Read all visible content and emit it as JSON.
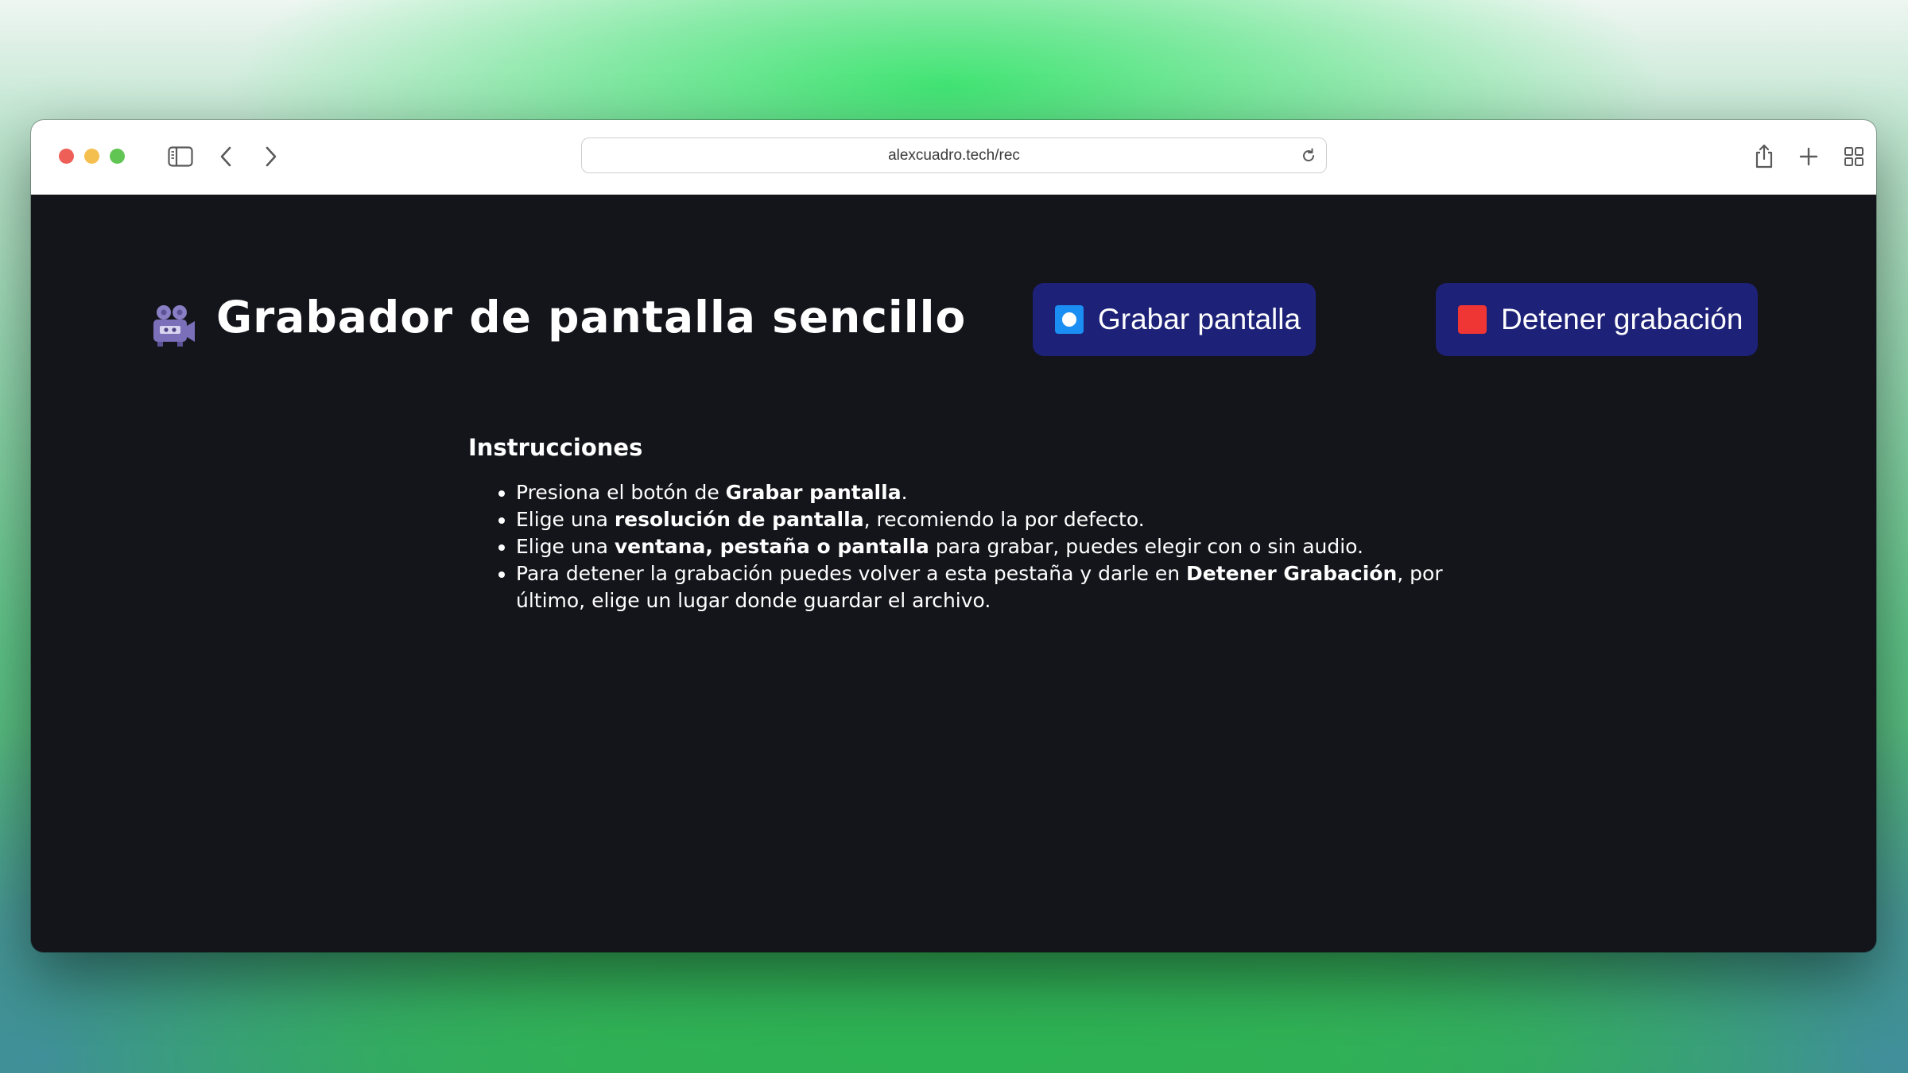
{
  "browser": {
    "url": "alexcuadro.tech/rec"
  },
  "page": {
    "title": "Grabador de pantalla sencillo",
    "hero_icon": "video-camera-icon",
    "record_button": {
      "label": "Grabar pantalla",
      "icon": "record-button-icon",
      "color": "#1d2177",
      "icon_color": "#1a8ef2"
    },
    "stop_button": {
      "label": "Detener grabación",
      "icon": "stop-square-icon",
      "color": "#1d2177",
      "icon_color": "#f03535"
    },
    "background_color": "#14141b"
  },
  "instructions": {
    "heading": "Instrucciones",
    "items": [
      {
        "parts": [
          {
            "text": "Presiona el botón de ",
            "bold": false
          },
          {
            "text": "Grabar pantalla",
            "bold": true
          },
          {
            "text": ".",
            "bold": false
          }
        ]
      },
      {
        "parts": [
          {
            "text": "Elige una ",
            "bold": false
          },
          {
            "text": "resolución de pantalla",
            "bold": true
          },
          {
            "text": ", recomiendo la por defecto.",
            "bold": false
          }
        ]
      },
      {
        "parts": [
          {
            "text": "Elige una ",
            "bold": false
          },
          {
            "text": "ventana, pestaña o pantalla",
            "bold": true
          },
          {
            "text": " para grabar, puedes elegir con o sin audio.",
            "bold": false
          }
        ]
      },
      {
        "parts": [
          {
            "text": "Para detener la grabación puedes volver a esta pestaña y darle en ",
            "bold": false
          },
          {
            "text": "Detener Grabación",
            "bold": true
          },
          {
            "text": ", por último, elige un lugar donde guardar el archivo.",
            "bold": false
          }
        ]
      }
    ]
  }
}
